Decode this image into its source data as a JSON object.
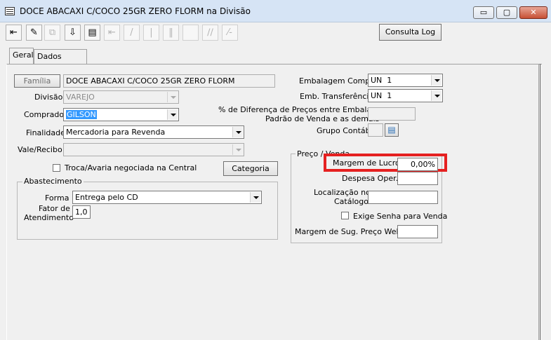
{
  "window": {
    "title": "DOCE ABACAXI C/COCO 25GR ZERO FLORM na Divisão",
    "min_label": "▭",
    "max_label": "▢",
    "close_label": "✕"
  },
  "toolbar": {
    "consulta_log": "Consulta Log",
    "icons": [
      "exit-icon",
      "edit-icon",
      "copy-icon",
      "download-icon",
      "print-icon",
      "first-icon",
      "prev-icon",
      "next-icon",
      "last-icon",
      "blank-icon",
      "chart-icon",
      "sort-icon"
    ]
  },
  "tabs": [
    "Geral",
    "Dados Fiscais"
  ],
  "left": {
    "familia_button": "Família",
    "familia_value": "DOCE ABACAXI C/COCO 25GR ZERO FLORM",
    "divisao_label": "Divisão",
    "divisao_value": "VAREJO",
    "comprador_label": "Comprador",
    "comprador_value": "GILSON",
    "finalidade_label": "Finalidade",
    "finalidade_value": "Mercadoria para Revenda",
    "vale_label": "Vale/Recibo",
    "vale_value": "",
    "troca_label": "Troca/Avaria negociada na Central",
    "categoria_button": "Categoria"
  },
  "abastecimento": {
    "title": "Abastecimento",
    "forma_label": "Forma",
    "forma_value": "Entrega pelo CD",
    "fator_label_1": "Fator de",
    "fator_label_2": "Atendimento",
    "fator_value": "1,0"
  },
  "right": {
    "emb_compra_label": "Embalagem Compra",
    "emb_compra_value": "UN  1",
    "emb_transf_label": "Emb. Transferência",
    "emb_transf_value": "UN  1",
    "dif_label_1": "% de Diferença de Preços entre Embalagem",
    "dif_label_2": "Padrão de Venda e as demais",
    "dif_value": "",
    "grupo_label": "Grupo Contábil",
    "grupo_value": ""
  },
  "preco": {
    "title": "Preço / Venda",
    "margem_label": "Margem de Lucro",
    "margem_value": "0,00%",
    "despesa_label": "Despesa Oper.",
    "despesa_value": "",
    "local_label_1": "Localização no",
    "local_label_2": "Catálogo",
    "local_value": "",
    "exige_label": "Exige Senha para Venda",
    "margem_sug_label": "Margem de Sug. Preço Web",
    "margem_sug_value": ""
  },
  "colors": {
    "highlight": "#e52121",
    "selection": "#3399ff"
  }
}
